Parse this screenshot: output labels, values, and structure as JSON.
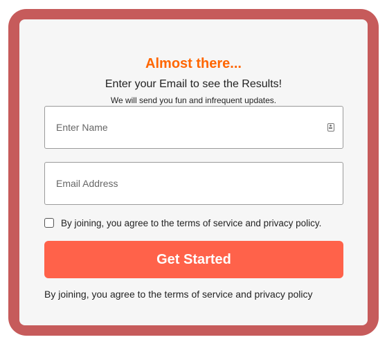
{
  "form": {
    "headline": "Almost there...",
    "subheadline": "Enter your Email to see the Results!",
    "note": "We will send you fun and infrequent updates.",
    "name_placeholder": "Enter Name",
    "email_placeholder": "Email Address",
    "name_field_icon": "contact-card-icon",
    "consent_checked": false,
    "consent_label": "By joining, you agree to the terms of service and privacy policy.",
    "submit_label": "Get Started",
    "footer_text": "By joining, you agree to the terms of service and privacy policy"
  },
  "colors": {
    "frame": "#c65b5b",
    "card": "#f6f6f6",
    "headline": "#ff6600",
    "button": "#ff624a"
  }
}
